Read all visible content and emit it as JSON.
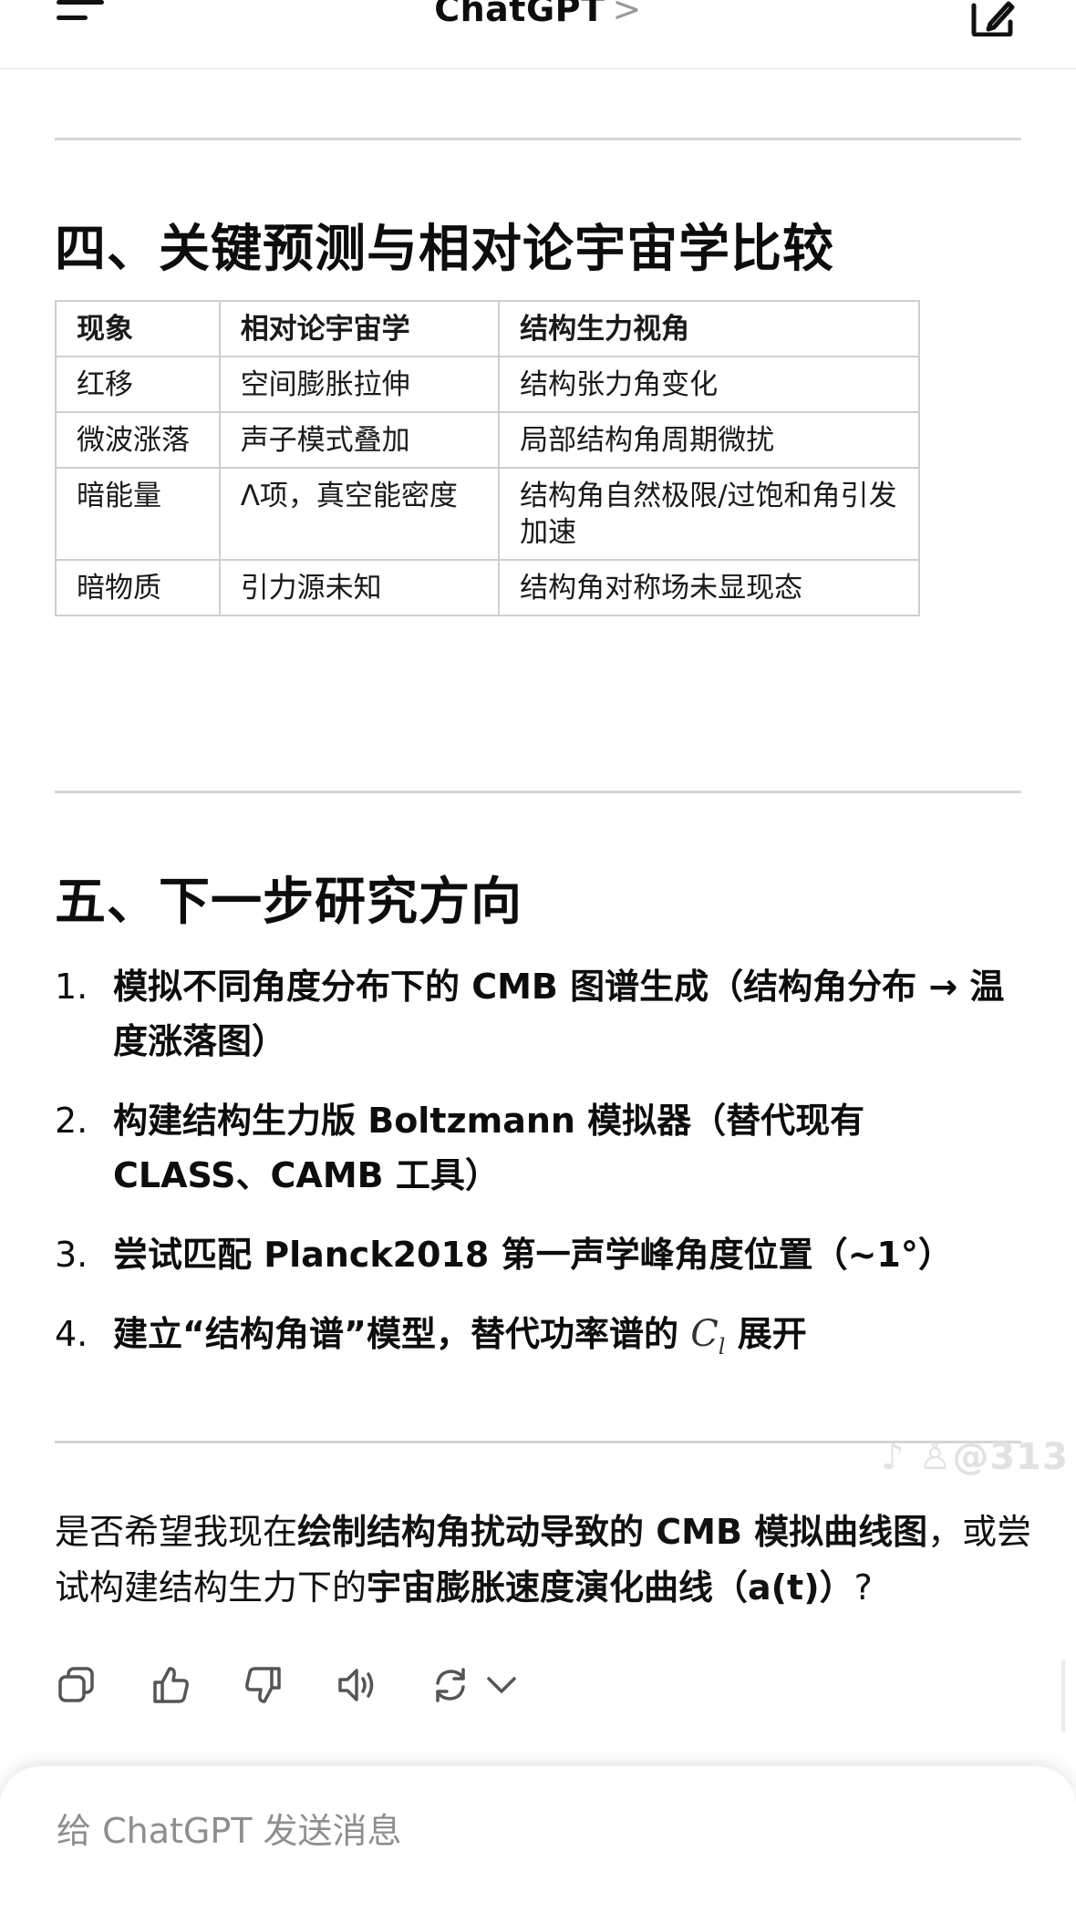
{
  "header": {
    "title": "ChatGPT",
    "chevron": ">"
  },
  "section4": {
    "heading": "四、关键预测与相对论宇宙学比较",
    "table": {
      "headers": [
        "现象",
        "相对论宇宙学",
        "结构生力视角"
      ],
      "rows": [
        [
          "红移",
          "空间膨胀拉伸",
          "结构张力角变化"
        ],
        [
          "微波涨落",
          "声子模式叠加",
          "局部结构角周期微扰"
        ],
        [
          "暗能量",
          "Λ项，真空能密度",
          "结构角自然极限/过饱和角引发加速"
        ],
        [
          "暗物质",
          "引力源未知",
          "结构角对称场未显现态"
        ]
      ]
    }
  },
  "section5": {
    "heading": "五、下一步研究方向",
    "items": [
      {
        "num": "1.",
        "text": "模拟不同角度分布下的 CMB 图谱生成（结构角分布 → 温度涨落图）"
      },
      {
        "num": "2.",
        "text": "构建结构生力版 Boltzmann 模拟器（替代现有 CLASS、CAMB 工具）"
      },
      {
        "num": "3.",
        "text": "尝试匹配 Planck2018 第一声学峰角度位置（~1°）"
      },
      {
        "num": "4.",
        "text_before": "建立“结构角谱”模型，替代功率谱的 ",
        "math_main": "C",
        "math_sub": "l",
        "text_after": " 展开"
      }
    ]
  },
  "watermark": "@313",
  "question": {
    "p1": "是否希望我现在",
    "b1": "绘制结构角扰动导致的 CMB 模拟曲线图",
    "p2": "，或尝试构建结构生力下的",
    "b2": "宇宙膨胀速度演化曲线（a(t)）",
    "p3": "?"
  },
  "actions": [
    "copy-icon",
    "thumbs-up-icon",
    "thumbs-down-icon",
    "read-aloud-icon",
    "regenerate-icon",
    "chevron-down-icon"
  ],
  "composer": {
    "placeholder": "给 ChatGPT 发送消息"
  }
}
